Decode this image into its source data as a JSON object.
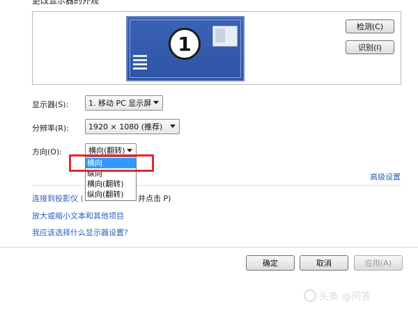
{
  "header": {
    "title_partial": "更改显示器的外观"
  },
  "preview": {
    "monitor_number": "1",
    "detect_label": "检测(C)",
    "identify_label": "识别(I)"
  },
  "settings": {
    "display_label": "显示器(S):",
    "display_value": "1. 移动 PC 显示屏",
    "resolution_label": "分辨率(R):",
    "resolution_value": "1920 × 1080 (推荐)",
    "orientation_label": "方向(O):",
    "orientation_value": "横向(翻转)",
    "orientation_options": [
      "横向",
      "纵向",
      "横向(翻转)",
      "纵向(翻转)"
    ],
    "orientation_highlighted": "横向"
  },
  "links": {
    "advanced": "高级设置",
    "projector_start": "连接到投影仪 (",
    "projector_end": "并点击 P)",
    "text_size": "放大或缩小文本和其他项目",
    "which_settings": "我应该选择什么显示器设置?"
  },
  "footer": {
    "ok_label": "确定",
    "cancel_label": "取消",
    "apply_label": "应用(A)"
  },
  "watermark": "头条 @问答"
}
